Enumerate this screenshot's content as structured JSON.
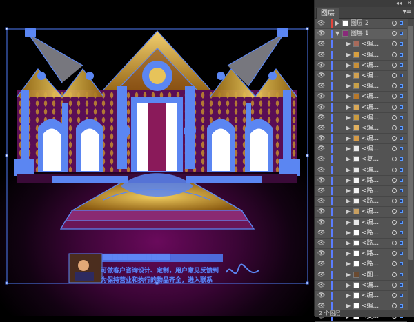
{
  "panel": {
    "tab_label": "图层",
    "menu_icon": "panel-menu-icon",
    "footer_label": "2 个图层",
    "layers": [
      {
        "name": "图层 2",
        "color": "#e2453c",
        "expanded": false,
        "level": 0,
        "thumb": "#ffffff"
      },
      {
        "name": "图层 1",
        "color": "#5b7dff",
        "expanded": true,
        "level": 0,
        "thumb": "#8a2a7a"
      },
      {
        "name": "<编...",
        "color": "#5b7dff",
        "expanded": false,
        "level": 1,
        "thumb": "#a86a5a"
      },
      {
        "name": "<编...",
        "color": "#5b7dff",
        "expanded": false,
        "level": 1,
        "thumb": "#d8a040"
      },
      {
        "name": "<编...",
        "color": "#5b7dff",
        "expanded": false,
        "level": 1,
        "thumb": "#c89038"
      },
      {
        "name": "<编...",
        "color": "#5b7dff",
        "expanded": false,
        "level": 1,
        "thumb": "#d0a050"
      },
      {
        "name": "<编...",
        "color": "#5b7dff",
        "expanded": false,
        "level": 1,
        "thumb": "#c8a048"
      },
      {
        "name": "<编...",
        "color": "#5b7dff",
        "expanded": false,
        "level": 1,
        "thumb": "#b8782a"
      },
      {
        "name": "<编...",
        "color": "#5b7dff",
        "expanded": false,
        "level": 1,
        "thumb": "#d8a858"
      },
      {
        "name": "<编...",
        "color": "#5b7dff",
        "expanded": false,
        "level": 1,
        "thumb": "#c89a40"
      },
      {
        "name": "<编...",
        "color": "#5b7dff",
        "expanded": false,
        "level": 1,
        "thumb": "#e0b060"
      },
      {
        "name": "<编...",
        "color": "#5b7dff",
        "expanded": false,
        "level": 1,
        "thumb": "#d49a48"
      },
      {
        "name": "<编...",
        "color": "#5b7dff",
        "expanded": false,
        "level": 1,
        "thumb": "#e8e8e8"
      },
      {
        "name": "<复...",
        "color": "#5b7dff",
        "expanded": false,
        "level": 1,
        "thumb": "#f0f0f0"
      },
      {
        "name": "<编...",
        "color": "#5b7dff",
        "expanded": false,
        "level": 1,
        "thumb": "#e6e6e6"
      },
      {
        "name": "<路...",
        "color": "#5b7dff",
        "expanded": false,
        "level": 1,
        "thumb": "#f2f2f2"
      },
      {
        "name": "<路...",
        "color": "#5b7dff",
        "expanded": false,
        "level": 1,
        "thumb": "#f2f2f2"
      },
      {
        "name": "<路...",
        "color": "#5b7dff",
        "expanded": false,
        "level": 1,
        "thumb": "#f2f2f2"
      },
      {
        "name": "<编...",
        "color": "#5b7dff",
        "expanded": false,
        "level": 1,
        "thumb": "#c9a060"
      },
      {
        "name": "<编...",
        "color": "#5b7dff",
        "expanded": false,
        "level": 1,
        "thumb": "#e9e9e9"
      },
      {
        "name": "<路...",
        "color": "#5b7dff",
        "expanded": false,
        "level": 1,
        "thumb": "#ffffff"
      },
      {
        "name": "<路...",
        "color": "#5b7dff",
        "expanded": false,
        "level": 1,
        "thumb": "#ffffff"
      },
      {
        "name": "<路...",
        "color": "#5b7dff",
        "expanded": false,
        "level": 1,
        "thumb": "#ffffff"
      },
      {
        "name": "<路...",
        "color": "#5b7dff",
        "expanded": false,
        "level": 1,
        "thumb": "#ffffff"
      },
      {
        "name": "<图...",
        "color": "#5b7dff",
        "expanded": false,
        "level": 1,
        "thumb": "#6a4a30"
      },
      {
        "name": "<编...",
        "color": "#5b7dff",
        "expanded": false,
        "level": 1,
        "thumb": "#ffffff"
      },
      {
        "name": "<编...",
        "color": "#5b7dff",
        "expanded": false,
        "level": 1,
        "thumb": "#ffffff"
      },
      {
        "name": "<编...",
        "color": "#5b7dff",
        "expanded": false,
        "level": 1,
        "thumb": "#ffffff"
      },
      {
        "name": "<复...",
        "color": "#5b7dff",
        "expanded": false,
        "level": 1,
        "thumb": "#ffffff"
      }
    ]
  },
  "canvas": {
    "caption_line1": "▇▇▇▇▇▇▇▇▇▇▇▇▇▇",
    "caption_line2": "可做客户咨询设计、定制，用户意见反馈到",
    "caption_line3": "为保持营业和执行的物品齐全，进入联系",
    "signature": "签名",
    "selection_color": "#4f7df7",
    "gold": "#d8a830",
    "purple": "#6a1060"
  }
}
